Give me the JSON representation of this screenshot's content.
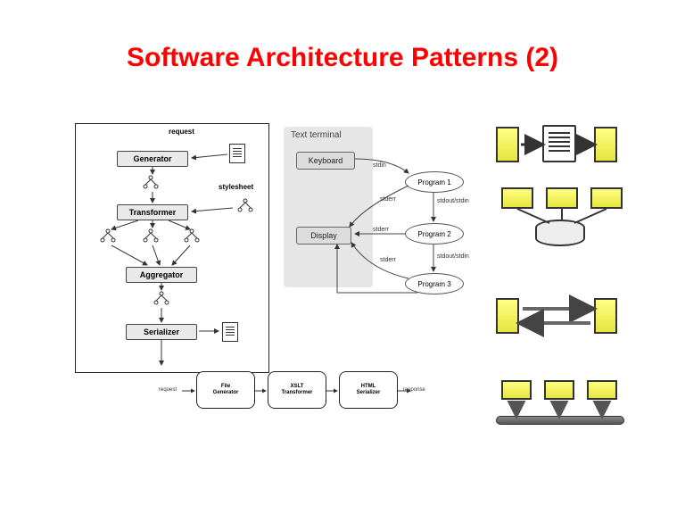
{
  "title": "Software Architecture Patterns (2)",
  "left": {
    "request": "request",
    "stylesheet": "stylesheet",
    "generator": "Generator",
    "transformer": "Transformer",
    "aggregator": "Aggregator",
    "serializer": "Serializer"
  },
  "mid": {
    "panel_title": "Text terminal",
    "keyboard": "Keyboard",
    "display": "Display",
    "program1": "Program 1",
    "program2": "Program 2",
    "program3": "Program 3",
    "stdin": "stdin",
    "stderr": "stderr",
    "stdout_stdin_a": "stdout/stdin",
    "stdout_stdin_b": "stdout/stdin"
  },
  "pipes": {
    "request": "request",
    "response": "response",
    "stage1a": "File",
    "stage1b": "Generator",
    "stage2a": "XSLT",
    "stage2b": "Transformer",
    "stage3a": "HTML",
    "stage3b": "Serializer"
  },
  "right": {
    "pattern1": "pipe-and-filter-icon",
    "pattern2": "shared-repository-icon",
    "pattern3": "client-server-icon",
    "pattern4": "bus-icon"
  }
}
